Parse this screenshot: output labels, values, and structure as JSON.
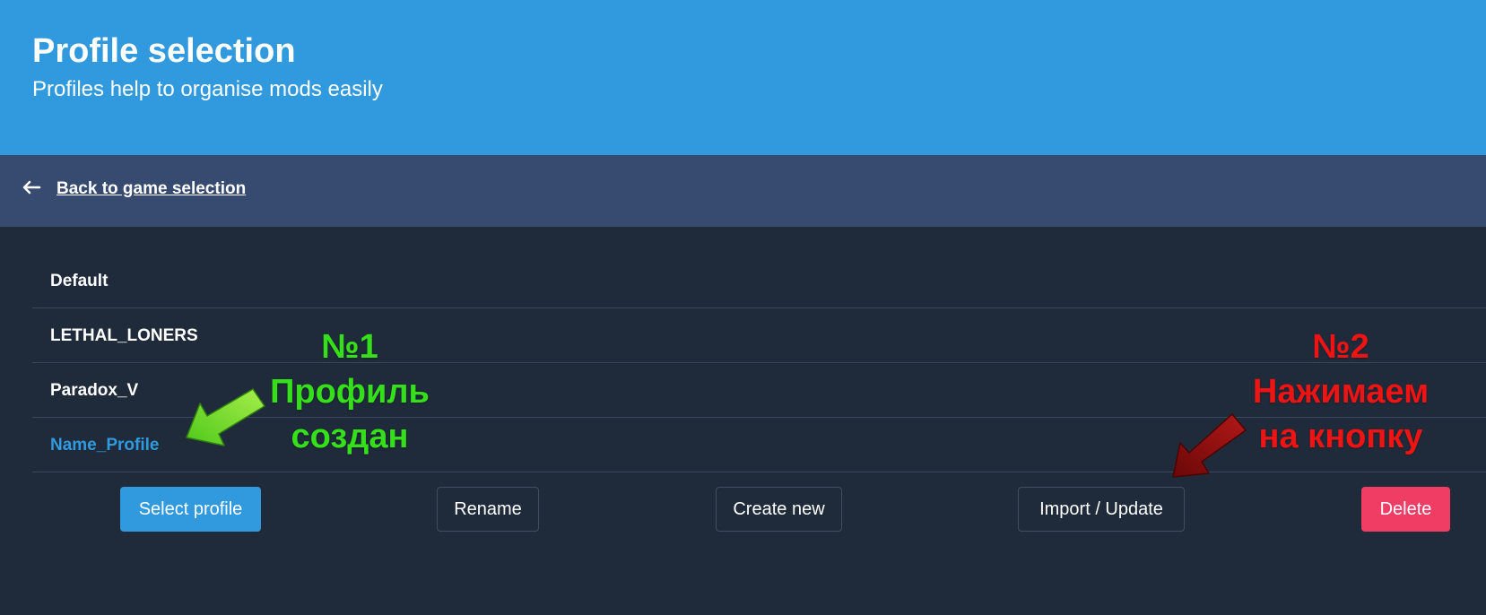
{
  "header": {
    "title": "Profile selection",
    "subtitle": "Profiles help to organise mods easily"
  },
  "nav": {
    "back_label": "Back to game selection",
    "back_icon": "arrow-left-icon"
  },
  "profiles": [
    {
      "name": "Default",
      "selected": false
    },
    {
      "name": "LETHAL_LONERS",
      "selected": false
    },
    {
      "name": "Paradox_V",
      "selected": false
    },
    {
      "name": "Name_Profile",
      "selected": true
    }
  ],
  "actions": {
    "select_label": "Select profile",
    "rename_label": "Rename",
    "create_label": "Create new",
    "import_label": "Import / Update",
    "delete_label": "Delete"
  },
  "annotations": {
    "note_1": {
      "line1": "№1",
      "line2": "Профиль",
      "line3": "создан",
      "color": "#35e01a"
    },
    "note_2": {
      "line1": "№2",
      "line2": "Нажимаем",
      "line3": "на кнопку",
      "color": "#ee1414"
    }
  },
  "colors": {
    "header_bg": "#3199dd",
    "nav_bg": "#374a6f",
    "page_bg": "#1f2b3a",
    "selected_text": "#3199dd",
    "primary_button": "#3199dd",
    "danger_button": "#ef3d64"
  }
}
